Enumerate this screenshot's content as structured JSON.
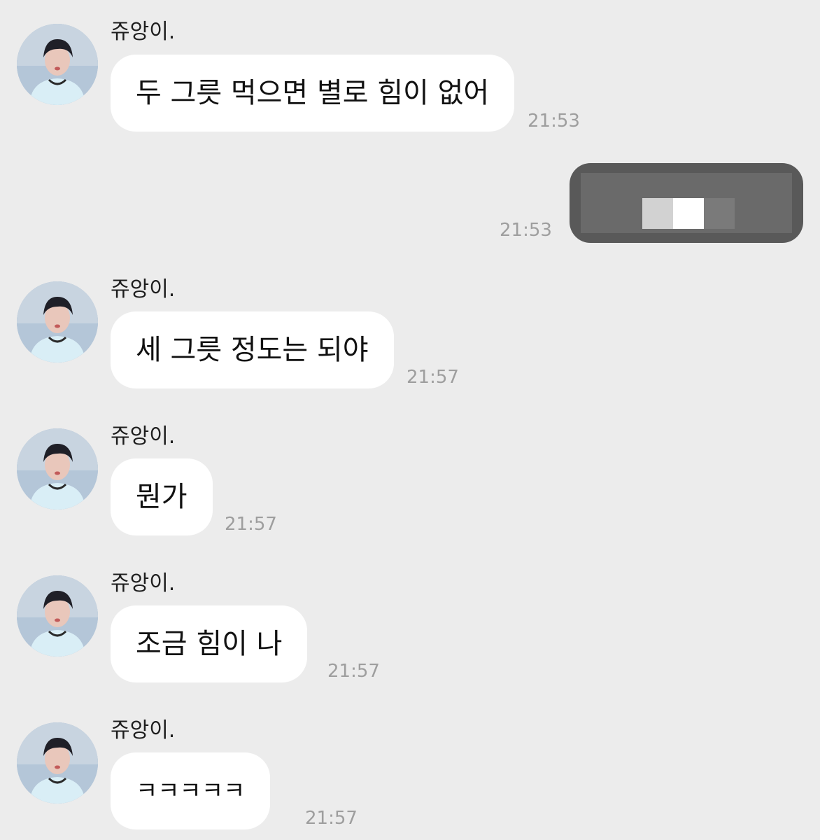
{
  "contact": {
    "name": "쥬앙이."
  },
  "colors": {
    "background": "#ececec",
    "incoming_bubble": "#ffffff",
    "outgoing_bubble": "#595959",
    "timestamp": "#9e9e9e"
  },
  "messages": [
    {
      "direction": "incoming",
      "sender": "쥬앙이.",
      "text": "두 그릇 먹으면 별로 힘이 없어",
      "time": "21:53"
    },
    {
      "direction": "outgoing",
      "text": "",
      "content": "redacted-image",
      "time": "21:53"
    },
    {
      "direction": "incoming",
      "sender": "쥬앙이.",
      "text": "세 그릇 정도는 되야",
      "time": "21:57"
    },
    {
      "direction": "incoming",
      "sender": "쥬앙이.",
      "text": "뭔가",
      "time": "21:57"
    },
    {
      "direction": "incoming",
      "sender": "쥬앙이.",
      "text": "조금 힘이 나",
      "time": "21:57"
    },
    {
      "direction": "incoming",
      "sender": "쥬앙이.",
      "text": "ㅋㅋㅋㅋㅋ",
      "time": "21:57"
    }
  ]
}
